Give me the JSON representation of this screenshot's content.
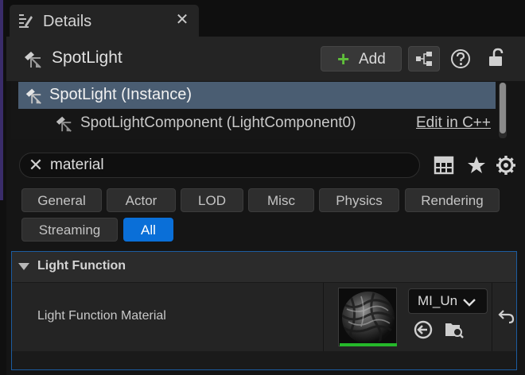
{
  "tab": {
    "title": "Details",
    "close_glyph": "✕",
    "icon": "details-icon"
  },
  "actor": {
    "name": "SpotLight",
    "icon": "spotlight-icon",
    "add_label": "Add",
    "add_glyph": "+",
    "blueprint_icon": "blueprint-icon",
    "help_icon": "help-icon",
    "lock_icon": "unlock-icon"
  },
  "components": {
    "items": [
      {
        "label": "SpotLight (Instance)",
        "selected": true,
        "icon": "spotlight-icon"
      },
      {
        "label": "SpotLightComponent (LightComponent0)",
        "selected": false,
        "icon": "spotlight-icon"
      }
    ],
    "edit_link": "Edit in C++"
  },
  "search": {
    "value": "material",
    "clear_glyph": "✕"
  },
  "toolbar": {
    "icons": [
      "table-view-icon",
      "favorites-star-icon",
      "settings-gear-icon"
    ]
  },
  "categories": [
    {
      "label": "General",
      "active": false
    },
    {
      "label": "Actor",
      "active": false
    },
    {
      "label": "LOD",
      "active": false
    },
    {
      "label": "Misc",
      "active": false
    },
    {
      "label": "Physics",
      "active": false
    },
    {
      "label": "Rendering",
      "active": false
    },
    {
      "label": "Streaming",
      "active": false
    },
    {
      "label": "All",
      "active": true
    }
  ],
  "section": {
    "title": "Light Function",
    "property": {
      "label": "Light Function Material",
      "asset_value": "MI_Un",
      "icons": [
        "use-selected-asset-icon",
        "browse-asset-icon",
        "reset-to-default-icon"
      ]
    }
  },
  "colors": {
    "selection": "#4a5d72",
    "active_chip": "#0a6fd8",
    "add_plus": "#5fbf3a",
    "asset_bar": "#25b82a",
    "section_border": "#1c5ca0"
  }
}
